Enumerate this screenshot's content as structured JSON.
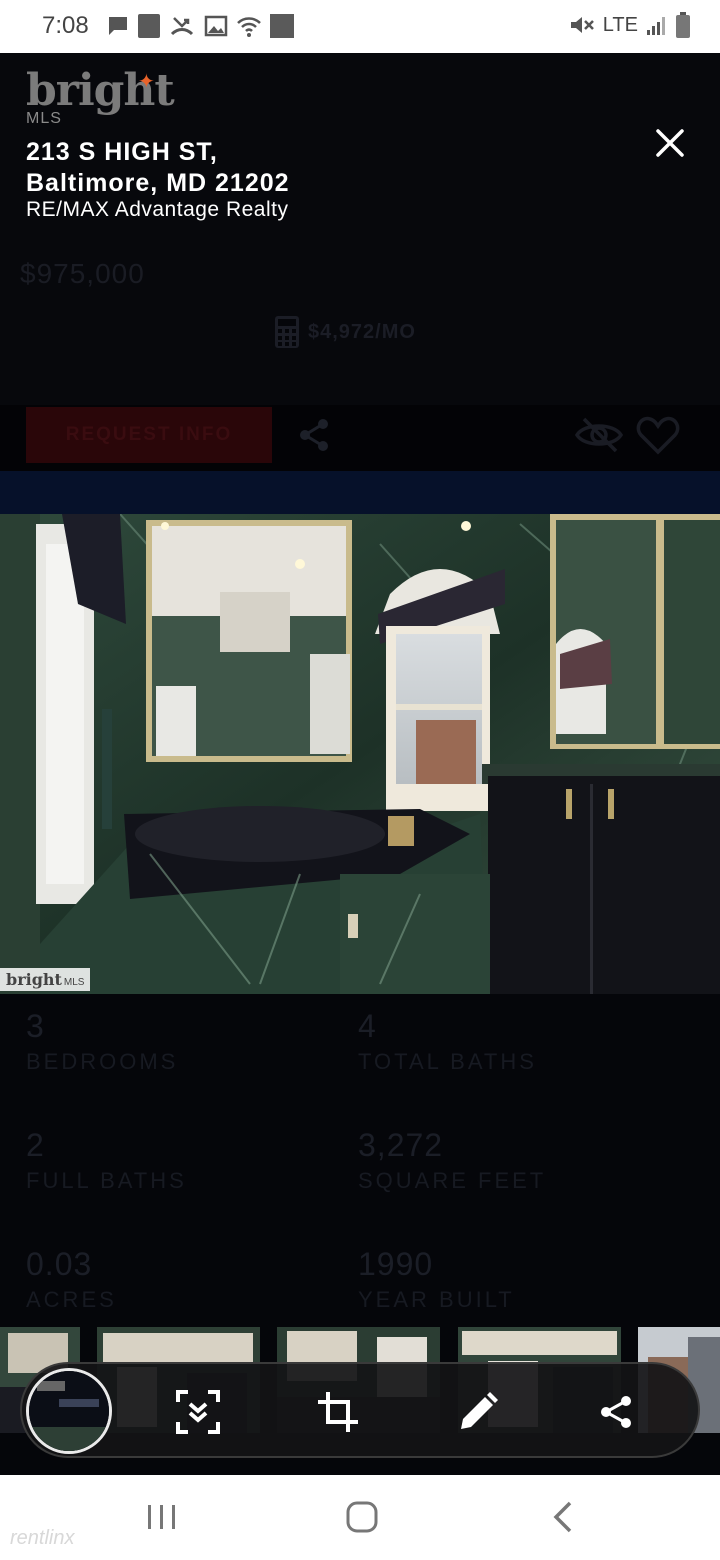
{
  "status_bar": {
    "time": "7:08",
    "network": "LTE",
    "left_icons": [
      "message-icon",
      "square-icon",
      "missed-call-icon",
      "image-icon",
      "wifi-icon",
      "app-icon"
    ],
    "right_icons": [
      "mute-icon",
      "signal-icon",
      "battery-icon"
    ]
  },
  "listing": {
    "brand_word": "bright",
    "brand_sub": "MLS",
    "address_line1": "213 S HIGH ST,",
    "address_line2": "Baltimore, MD 21202",
    "agency": "RE/MAX Advantage Realty",
    "price": "$975,000",
    "monthly": "$4,972/MO",
    "request_label": "REQUEST INFO"
  },
  "photo": {
    "watermark": "bright",
    "watermark_sub": "MLS"
  },
  "facts": [
    {
      "value": "3",
      "label": "BEDROOMS"
    },
    {
      "value": "4",
      "label": "TOTAL BATHS"
    },
    {
      "value": "2",
      "label": "FULL BATHS"
    },
    {
      "value": "3,272",
      "label": "SQUARE FEET"
    },
    {
      "value": "0.03",
      "label": "ACRES"
    },
    {
      "value": "1990",
      "label": "YEAR BUILT"
    }
  ],
  "footer": {
    "watermark": "rentlinx"
  },
  "colors": {
    "accent_red": "#2a0609",
    "brand_orange": "#e8632a",
    "overlay": "#05060a"
  }
}
